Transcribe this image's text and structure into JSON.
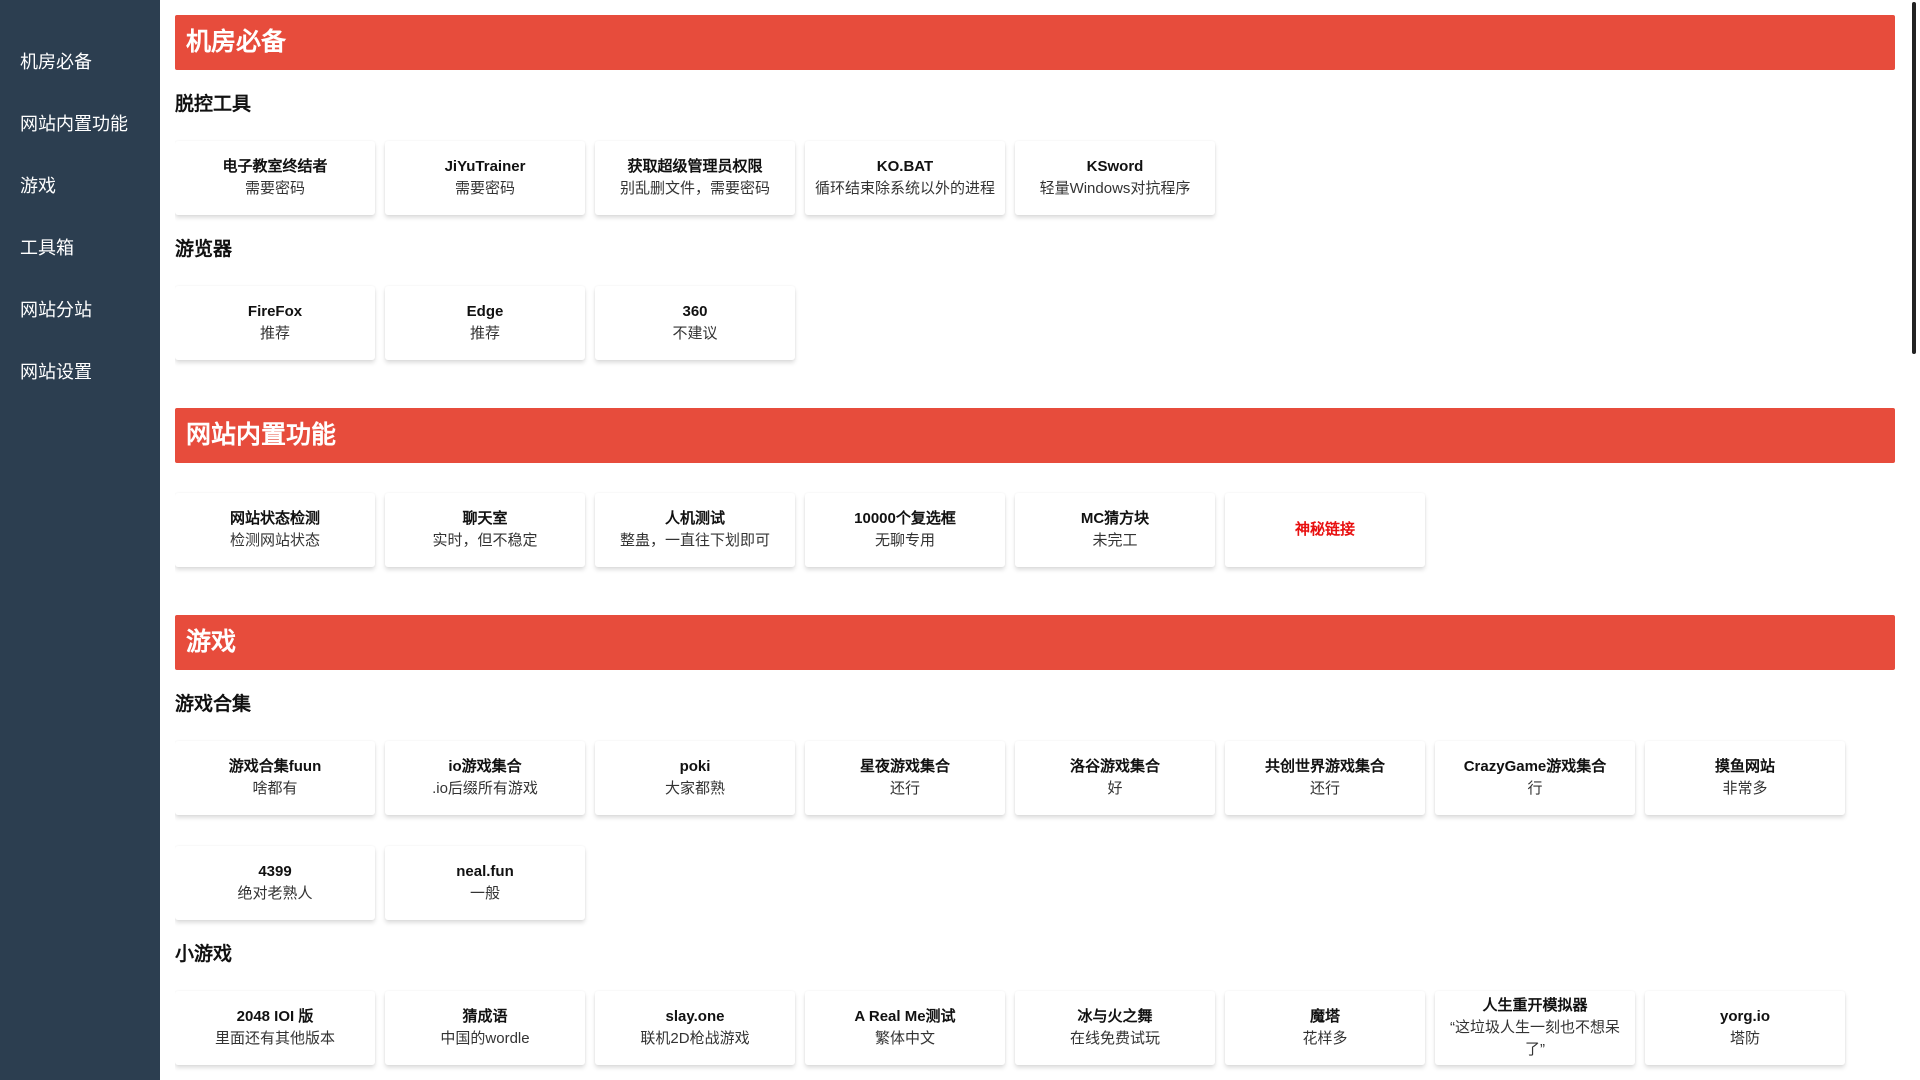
{
  "sidebar": {
    "items": [
      {
        "label": "机房必备"
      },
      {
        "label": "网站内置功能"
      },
      {
        "label": "游戏"
      },
      {
        "label": "工具箱"
      },
      {
        "label": "网站分站"
      },
      {
        "label": "网站设置"
      }
    ]
  },
  "sections": [
    {
      "title": "机房必备",
      "groups": [
        {
          "subtitle": "脱控工具",
          "cards": [
            {
              "title": "电子教室终结者",
              "desc": "需要密码"
            },
            {
              "title": "JiYuTrainer",
              "desc": "需要密码"
            },
            {
              "title": "获取超级管理员权限",
              "desc": "别乱删文件，需要密码"
            },
            {
              "title": "KO.BAT",
              "desc": "循环结束除系统以外的进程"
            },
            {
              "title": "KSword",
              "desc": "轻量Windows对抗程序"
            }
          ]
        },
        {
          "subtitle": "游览器",
          "cards": [
            {
              "title": "FireFox",
              "desc": "推荐"
            },
            {
              "title": "Edge",
              "desc": "推荐"
            },
            {
              "title": "360",
              "desc": "不建议"
            }
          ]
        }
      ]
    },
    {
      "title": "网站内置功能",
      "cards": [
        {
          "title": "网站状态检测",
          "desc": "检测网站状态"
        },
        {
          "title": "聊天室",
          "desc": "实时，但不稳定"
        },
        {
          "title": "人机测试",
          "desc": "整蛊，一直往下划即可"
        },
        {
          "title": "10000个复选框",
          "desc": "无聊专用"
        },
        {
          "title": "MC猜方块",
          "desc": "未完工"
        },
        {
          "title": "神秘链接",
          "desc": ""
        }
      ]
    },
    {
      "title": "游戏",
      "groups": [
        {
          "subtitle": "游戏合集",
          "cards": [
            {
              "title": "游戏合集fuun",
              "desc": "啥都有"
            },
            {
              "title": "io游戏集合",
              "desc": ".io后缀所有游戏"
            },
            {
              "title": "poki",
              "desc": "大家都熟"
            },
            {
              "title": "星夜游戏集合",
              "desc": "还行"
            },
            {
              "title": "洛谷游戏集合",
              "desc": "好"
            },
            {
              "title": "共创世界游戏集合",
              "desc": "还行"
            },
            {
              "title": "CrazyGame游戏集合",
              "desc": "行"
            },
            {
              "title": "摸鱼网站",
              "desc": "非常多"
            },
            {
              "title": "4399",
              "desc": "绝对老熟人"
            },
            {
              "title": "neal.fun",
              "desc": "一般"
            }
          ]
        },
        {
          "subtitle": "小游戏",
          "cards": [
            {
              "title": "2048 IOI 版",
              "desc": "里面还有其他版本"
            },
            {
              "title": "猜成语",
              "desc": "中国的wordle"
            },
            {
              "title": "slay.one",
              "desc": "联机2D枪战游戏"
            },
            {
              "title": "A Real Me测试",
              "desc": "繁体中文"
            },
            {
              "title": "冰与火之舞",
              "desc": "在线免费试玩"
            },
            {
              "title": "魔塔",
              "desc": "花样多"
            },
            {
              "title": "人生重开模拟器",
              "desc": "“这垃圾人生一刻也不想呆了”"
            },
            {
              "title": "yorg.io",
              "desc": "塔防"
            }
          ]
        }
      ]
    }
  ],
  "colors": {
    "sidebar_bg": "#2c3e50",
    "section_header_bg": "#e74c3c",
    "special_link": "#e81010"
  }
}
